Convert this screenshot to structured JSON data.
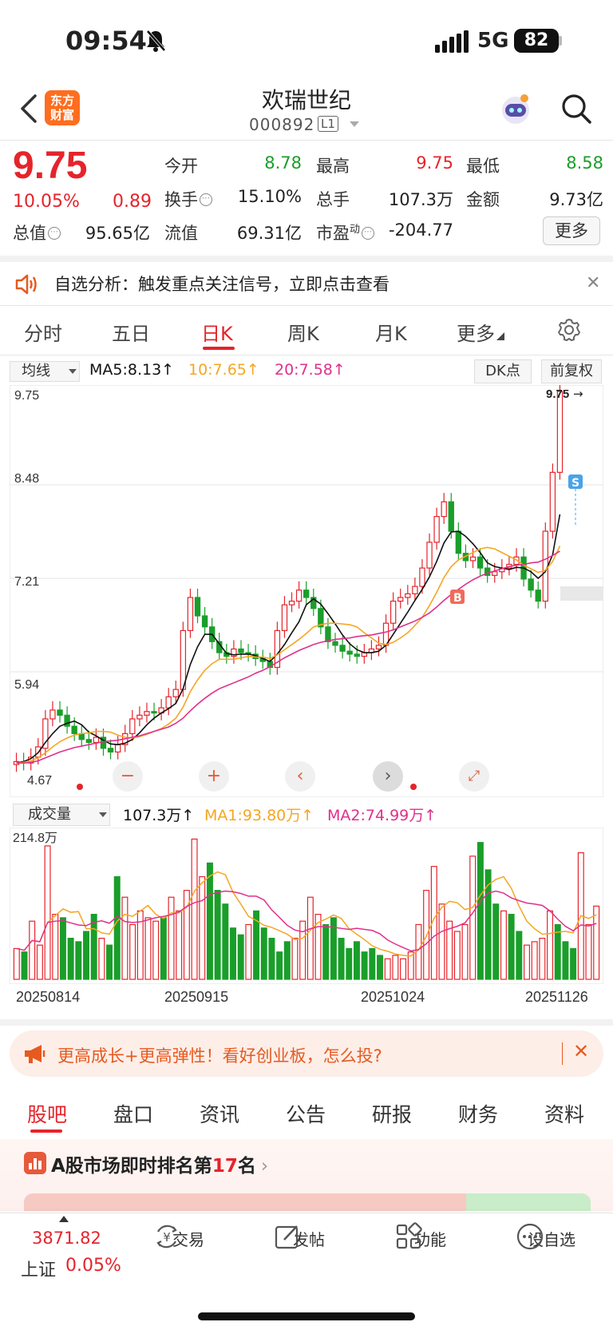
{
  "status": {
    "time": "09:54",
    "network": "5G",
    "battery": "82"
  },
  "header": {
    "logo_line1": "东方",
    "logo_line2": "财富",
    "name": "欢瑞世纪",
    "code": "000892",
    "level": "L1"
  },
  "quote": {
    "price": "9.75",
    "pct": "10.05%",
    "change": "0.89",
    "open_label": "今开",
    "open": "8.78",
    "high_label": "最高",
    "high": "9.75",
    "low_label": "最低",
    "low": "8.58",
    "turnover_label": "换手",
    "turnover": "15.10%",
    "volume_label": "总手",
    "volume": "107.3万",
    "amount_label": "金额",
    "amount": "9.73亿",
    "mcap_label": "总值",
    "mcap": "95.65亿",
    "float_label": "流值",
    "float": "69.31亿",
    "pe_label": "市盈",
    "pe_sup": "动",
    "pe": "-204.77",
    "more": "更多"
  },
  "promo": {
    "text": "自选分析：触发重点关注信号，立即点击查看"
  },
  "period_tabs": [
    "分时",
    "五日",
    "日K",
    "周K",
    "月K",
    "更多"
  ],
  "ma_legend": {
    "select": "均线",
    "ma5": "MA5:8.13↑",
    "ma10": "10:7.65↑",
    "ma20": "20:7.58↑",
    "dk": "DK点",
    "fq": "前复权"
  },
  "colors": {
    "up": "#e5242b",
    "down": "#1a9e2a",
    "ma5": "#111111",
    "ma10": "#f5a623",
    "ma20": "#e0308c"
  },
  "chart_data": [
    {
      "type": "candlestick",
      "y_ticks": [
        "9.75",
        "8.48",
        "7.21",
        "5.94",
        "4.67"
      ],
      "ylim": [
        4.67,
        9.75
      ],
      "annotations": {
        "high_marker": "9.75",
        "low_marker": "4.67",
        "buy": "B",
        "sell": "S"
      },
      "close": [
        4.72,
        4.7,
        4.78,
        4.92,
        5.3,
        5.42,
        5.35,
        5.2,
        5.1,
        5.02,
        4.98,
        5.05,
        4.9,
        4.85,
        4.95,
        5.1,
        5.3,
        5.35,
        5.4,
        5.38,
        5.45,
        5.6,
        5.7,
        6.5,
        6.95,
        6.7,
        6.55,
        6.35,
        6.2,
        6.15,
        6.25,
        6.2,
        6.18,
        6.12,
        6.08,
        6.0,
        6.5,
        6.85,
        6.9,
        7.05,
        6.95,
        6.8,
        6.55,
        6.35,
        6.3,
        6.22,
        6.18,
        6.15,
        6.2,
        6.25,
        6.3,
        6.6,
        6.9,
        6.95,
        7.0,
        7.1,
        7.35,
        7.7,
        8.05,
        8.25,
        7.85,
        7.55,
        7.45,
        7.5,
        7.35,
        7.25,
        7.3,
        7.35,
        7.4,
        7.5,
        7.2,
        7.05,
        6.9,
        7.85,
        8.65,
        9.75
      ],
      "open": [
        4.68,
        4.72,
        4.7,
        4.78,
        4.9,
        5.3,
        5.42,
        5.35,
        5.2,
        5.1,
        5.02,
        4.98,
        5.05,
        4.9,
        4.85,
        4.95,
        5.1,
        5.3,
        5.35,
        5.4,
        5.38,
        5.45,
        5.6,
        5.7,
        6.5,
        6.95,
        6.7,
        6.55,
        6.35,
        6.2,
        6.15,
        6.25,
        6.2,
        6.18,
        6.12,
        6.08,
        6.0,
        6.5,
        6.85,
        6.9,
        7.05,
        6.95,
        6.8,
        6.55,
        6.35,
        6.3,
        6.22,
        6.18,
        6.15,
        6.2,
        6.25,
        6.3,
        6.6,
        6.9,
        6.95,
        7.0,
        7.1,
        7.35,
        7.7,
        8.05,
        8.25,
        7.85,
        7.55,
        7.45,
        7.5,
        7.35,
        7.25,
        7.3,
        7.35,
        7.4,
        7.5,
        7.2,
        7.05,
        6.9,
        7.85,
        8.65
      ],
      "ma5": [
        4.7,
        4.72,
        4.76,
        4.84,
        4.98,
        5.1,
        5.2,
        5.24,
        5.27,
        5.22,
        5.12,
        5.07,
        5.01,
        4.96,
        4.95,
        4.97,
        5.02,
        5.11,
        5.22,
        5.31,
        5.38,
        5.44,
        5.51,
        5.71,
        6.04,
        6.28,
        6.45,
        6.45,
        6.32,
        6.19,
        6.17,
        6.18,
        6.18,
        6.16,
        6.12,
        6.08,
        6.18,
        6.31,
        6.47,
        6.62,
        6.85,
        6.93,
        6.86,
        6.73,
        6.59,
        6.44,
        6.32,
        6.24,
        6.2,
        6.2,
        6.22,
        6.3,
        6.45,
        6.6,
        6.75,
        6.91,
        7.06,
        7.23,
        7.44,
        7.69,
        7.84,
        7.85,
        7.78,
        7.68,
        7.56,
        7.42,
        7.37,
        7.35,
        7.33,
        7.36,
        7.35,
        7.3,
        7.21,
        7.3,
        7.53,
        8.08
      ],
      "ma10": [
        4.7,
        4.71,
        4.73,
        4.77,
        4.84,
        4.92,
        4.99,
        5.04,
        5.08,
        5.1,
        5.11,
        5.13,
        5.13,
        5.12,
        5.08,
        5.05,
        5.04,
        5.06,
        5.09,
        5.13,
        5.17,
        5.23,
        5.31,
        5.46,
        5.67,
        5.83,
        5.96,
        6.05,
        6.11,
        6.11,
        6.11,
        6.13,
        6.15,
        6.14,
        6.14,
        6.12,
        6.17,
        6.24,
        6.31,
        6.38,
        6.46,
        6.55,
        6.58,
        6.6,
        6.6,
        6.59,
        6.58,
        6.55,
        6.47,
        6.4,
        6.33,
        6.31,
        6.34,
        6.4,
        6.47,
        6.57,
        6.68,
        6.84,
        7.02,
        7.22,
        7.37,
        7.46,
        7.51,
        7.56,
        7.61,
        7.63,
        7.61,
        7.56,
        7.51,
        7.46,
        7.39,
        7.34,
        7.29,
        7.32,
        7.44,
        7.65
      ],
      "ma20": [
        4.7,
        4.7,
        4.71,
        4.73,
        4.77,
        4.81,
        4.85,
        4.88,
        4.91,
        4.93,
        4.95,
        4.97,
        4.99,
        5.0,
        5.01,
        5.03,
        5.05,
        5.07,
        5.1,
        5.13,
        5.16,
        5.19,
        5.24,
        5.31,
        5.41,
        5.5,
        5.58,
        5.65,
        5.71,
        5.75,
        5.79,
        5.83,
        5.87,
        5.92,
        5.96,
        6.01,
        6.07,
        6.13,
        6.18,
        6.23,
        6.27,
        6.31,
        6.34,
        6.36,
        6.38,
        6.39,
        6.4,
        6.42,
        6.43,
        6.44,
        6.46,
        6.48,
        6.51,
        6.55,
        6.59,
        6.63,
        6.68,
        6.74,
        6.82,
        6.91,
        6.99,
        7.06,
        7.13,
        7.19,
        7.24,
        7.28,
        7.31,
        7.34,
        7.37,
        7.39,
        7.4,
        7.42,
        7.43,
        7.47,
        7.52,
        7.58
      ]
    },
    {
      "type": "bar",
      "name": "成交量",
      "ymax_label": "214.8万",
      "ymax": 214.8,
      "latest": "107.3万↑",
      "ma1": "MA1:93.80万↑",
      "ma2": "MA2:74.99万↑",
      "dates": [
        "20250814",
        "20250915",
        "20251024",
        "20251126"
      ],
      "values": [
        45,
        40,
        85,
        50,
        195,
        95,
        90,
        60,
        55,
        70,
        95,
        60,
        50,
        150,
        120,
        80,
        100,
        90,
        85,
        90,
        120,
        100,
        130,
        205,
        150,
        170,
        130,
        110,
        75,
        65,
        80,
        100,
        75,
        60,
        40,
        55,
        60,
        85,
        120,
        95,
        80,
        90,
        60,
        45,
        55,
        40,
        45,
        35,
        30,
        35,
        30,
        40,
        80,
        130,
        165,
        110,
        85,
        70,
        80,
        180,
        200,
        160,
        110,
        100,
        95,
        70,
        50,
        55,
        60,
        100,
        80,
        55,
        45,
        185,
        80,
        107
      ]
    }
  ],
  "chart_controls": {
    "minus": "−",
    "plus": "+",
    "prev": "‹",
    "next": "›"
  },
  "banner": {
    "text": "更高成长+更高弹性！看好创业板，怎么投?"
  },
  "bottom_tabs": [
    "股吧",
    "盘口",
    "资讯",
    "公告",
    "研报",
    "财务",
    "资料"
  ],
  "rank": {
    "prefix": "A股市场即时排名第",
    "rank": "17",
    "suffix": "名"
  },
  "bottom_nav": {
    "index_value": "3871.82",
    "index_name": "上证",
    "index_pct": "0.05%",
    "trade": "交易",
    "post": "发帖",
    "func": "功能",
    "watch": "设自选"
  }
}
